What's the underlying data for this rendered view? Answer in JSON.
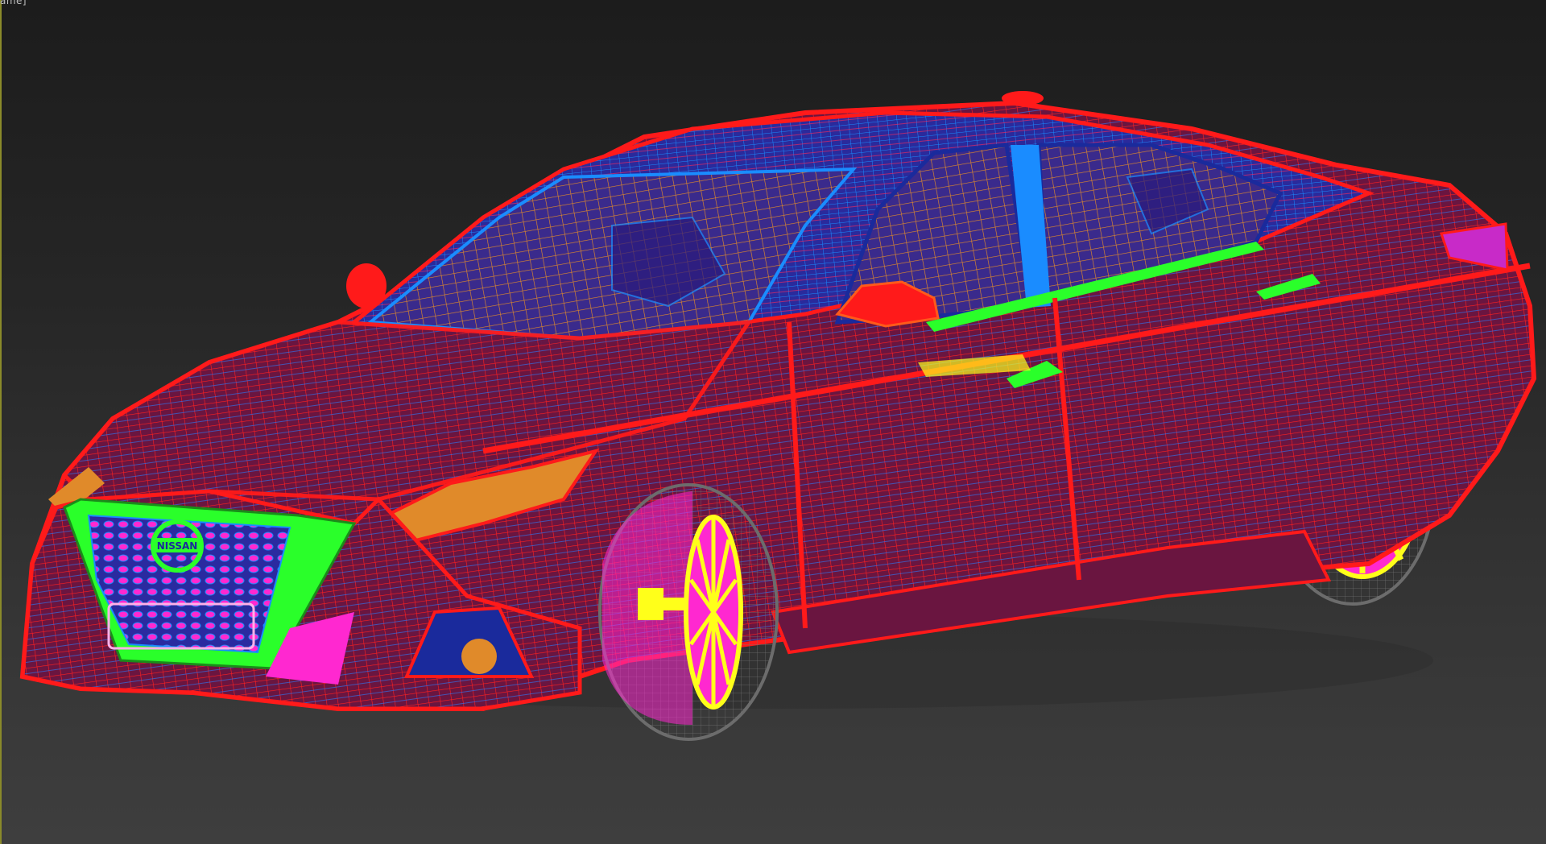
{
  "viewport": {
    "label": "ame]",
    "shading_mode": "wireframe",
    "colors": {
      "background_top": "#1c1c1c",
      "background_bottom": "#3e3e3e",
      "active_border": "#8a8a2a",
      "body": "#ff1a1a",
      "glass": "#e08a2a",
      "trim": "#1a8cff",
      "interior": "#1a2a9c",
      "grille": "#ff28d0",
      "accent": "#2aff2a",
      "wheel": "#ffff1a",
      "tire": "#6c6c6c"
    }
  },
  "model": {
    "badge_text": "NISSAN"
  }
}
